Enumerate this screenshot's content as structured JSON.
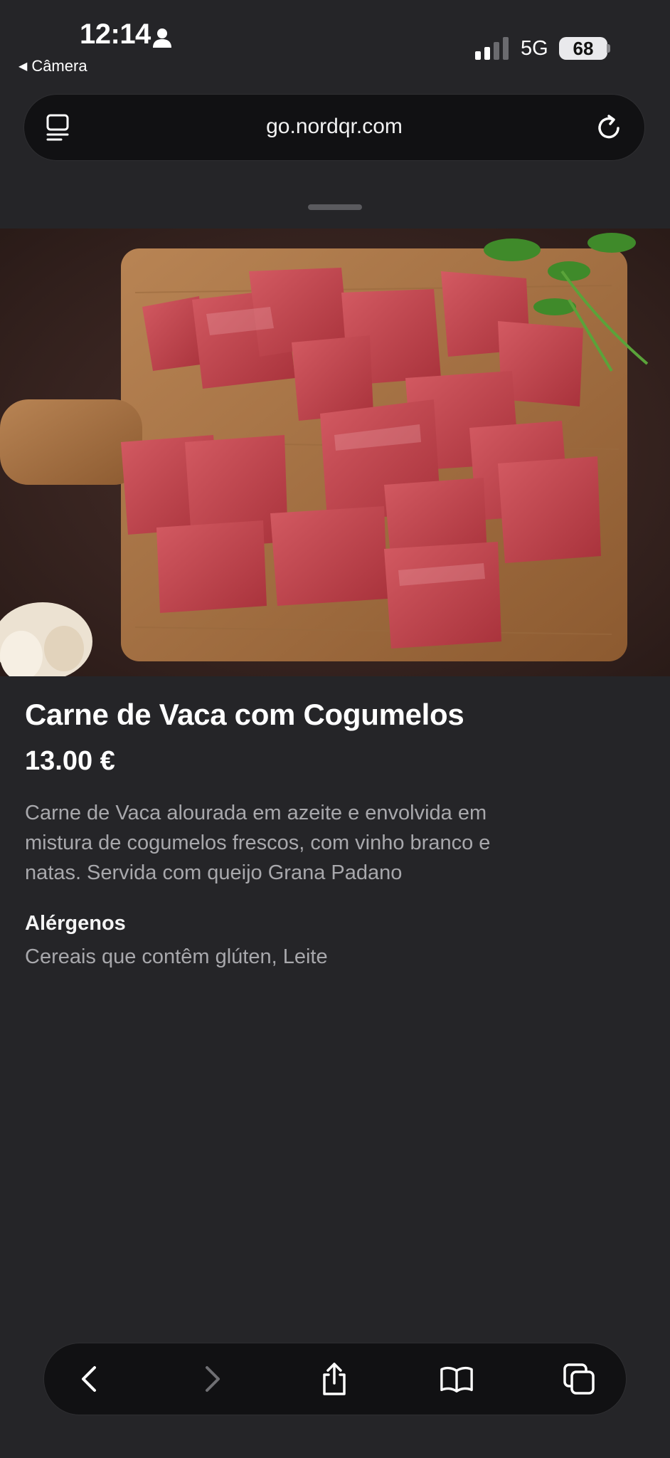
{
  "status_bar": {
    "time": "12:14",
    "back_app_label": "Câmera",
    "network": "5G",
    "battery": "68"
  },
  "browser": {
    "url": "go.nordqr.com"
  },
  "product": {
    "image_alt": "Carne de Vaca com Cogumelos",
    "name": "Carne de Vaca com Cogumelos",
    "price": "13.00 €",
    "description": "Carne de Vaca alourada em azeite e envolvida em mistura de cogumelos frescos, com vinho branco e natas. Servida com queijo Grana Padano",
    "allergens_title": "Alérgenos",
    "allergens": "Cereais que contêm glúten, Leite"
  },
  "toolbar": {
    "buttons": [
      "back-icon",
      "forward-icon",
      "share-icon",
      "bookmarks-icon",
      "tabs-icon"
    ]
  },
  "colors": {
    "background": "#252528",
    "bar": "#111113",
    "text_secondary": "#a8a8ac"
  }
}
